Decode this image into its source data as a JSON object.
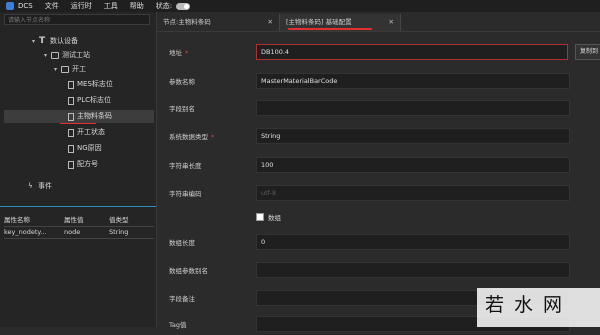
{
  "menubar": {
    "app": "DCS",
    "items": [
      "文件",
      "运行时",
      "工具",
      "帮助"
    ],
    "status_label": "状态:"
  },
  "left": {
    "search_placeholder": "请输入节点名称",
    "tree": [
      {
        "label": "数认设备"
      },
      {
        "label": "测试工站"
      },
      {
        "label": "开工"
      },
      {
        "label": "MES标志位"
      },
      {
        "label": "PLC标志位"
      },
      {
        "label": "主物料条码"
      },
      {
        "label": "开工状态"
      },
      {
        "label": "NG原因"
      },
      {
        "label": "配方号"
      }
    ],
    "events_label": "事件",
    "props": {
      "headers": [
        "属性名称",
        "属性值",
        "值类型"
      ],
      "rows": [
        [
          "key_nodety...",
          "node",
          "String"
        ]
      ]
    }
  },
  "tabs": [
    {
      "label": "节点:主物料条码"
    },
    {
      "label": "[主物料条码] 基础配置"
    }
  ],
  "form": {
    "address": {
      "label": "地址",
      "value": "DB100.4",
      "browse": "复制到"
    },
    "param_name": {
      "label": "参数名称",
      "value": "MasterMaterialBarCode"
    },
    "alias": {
      "label": "字段别名",
      "value": ""
    },
    "data_type": {
      "label": "系统数据类型",
      "value": "String"
    },
    "str_len": {
      "label": "字符串长度",
      "value": "100"
    },
    "encoding": {
      "label": "字符串编码",
      "value": "utf-8"
    },
    "is_array": {
      "label": "数组"
    },
    "array_len": {
      "label": "数组长度",
      "value": "0"
    },
    "array_alias": {
      "label": "数组参数别名",
      "value": ""
    },
    "remark": {
      "label": "字段备注",
      "value": ""
    },
    "tag": {
      "label": "Tag值",
      "value": ""
    }
  },
  "watermark": "若水网",
  "colors": {
    "required": "#e04040",
    "accent_line": "#2f8fbf",
    "annotation": "#e23030"
  }
}
